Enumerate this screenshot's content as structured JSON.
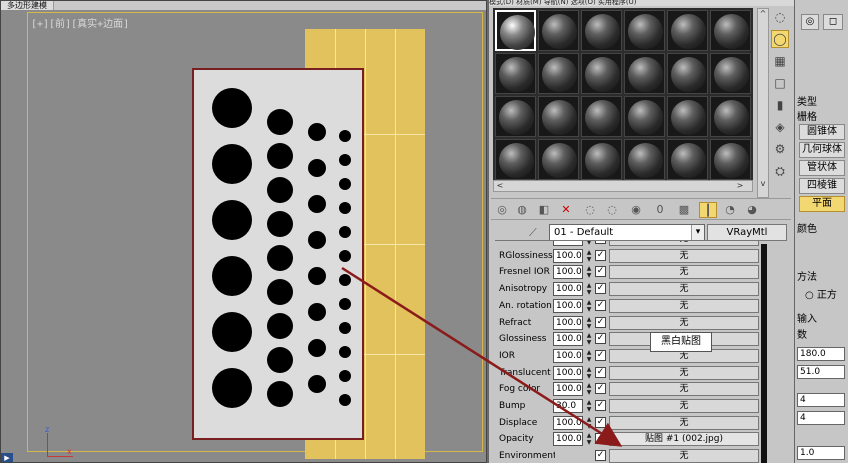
{
  "viewport": {
    "title_tab": "多边形建模",
    "label": "[+][前][真实+边面]",
    "axis_z": "z",
    "axis_x": "x",
    "y_marker": "y"
  },
  "material_editor": {
    "menubar": "模式(D)  材质(M)  导航(N)  选项(O)  实用程序(U)",
    "material_name": "01 - Default",
    "material_type": "VRayMtl",
    "slots_rows": 4,
    "slots_cols": 6,
    "maps": [
      {
        "label": "RGlossiness",
        "amount": "100.0",
        "checked": true,
        "map": "无"
      },
      {
        "label": "RGlossiness",
        "amount": "100.0",
        "checked": true,
        "map": "无"
      },
      {
        "label": "Fresnel IOR",
        "amount": "100.0",
        "checked": true,
        "map": "无"
      },
      {
        "label": "Anisotropy",
        "amount": "100.0",
        "checked": true,
        "map": "无"
      },
      {
        "label": "An. rotation",
        "amount": "100.0",
        "checked": true,
        "map": "无"
      },
      {
        "label": "Refract",
        "amount": "100.0",
        "checked": true,
        "map": "无"
      },
      {
        "label": "Glossiness",
        "amount": "100.0",
        "checked": true,
        "map": "无"
      },
      {
        "label": "IOR",
        "amount": "100.0",
        "checked": true,
        "map": "无"
      },
      {
        "label": "Translucent",
        "amount": "100.0",
        "checked": true,
        "map": "无"
      },
      {
        "label": "Fog color",
        "amount": "100.0",
        "checked": true,
        "map": "无"
      },
      {
        "label": "Bump",
        "amount": "30.0",
        "checked": true,
        "map": "无"
      },
      {
        "label": "Displace",
        "amount": "100.0",
        "checked": true,
        "map": "无"
      },
      {
        "label": "Opacity",
        "amount": "100.0",
        "checked": true,
        "map": "贴图 #1 (002.jpg)"
      },
      {
        "label": "Environment",
        "amount": "",
        "checked": true,
        "map": "无"
      }
    ],
    "tooltip": "黑白贴图"
  },
  "command_panel": {
    "type_label": "类型",
    "grid_label": "栅格",
    "buttons": [
      "圆锥体",
      "几何球体",
      "管状体",
      "四棱锥",
      "平面"
    ],
    "color_label": "颜色",
    "method_label": "方法",
    "radio_label": "正方",
    "input_label": "输入",
    "param_label": "数",
    "values": [
      "180.0",
      "51.0",
      "4",
      "4",
      "1.0"
    ]
  },
  "colors": {
    "accent": "#f3d770",
    "arrow": "#8b1a1a",
    "plane": "#e2c25c"
  }
}
